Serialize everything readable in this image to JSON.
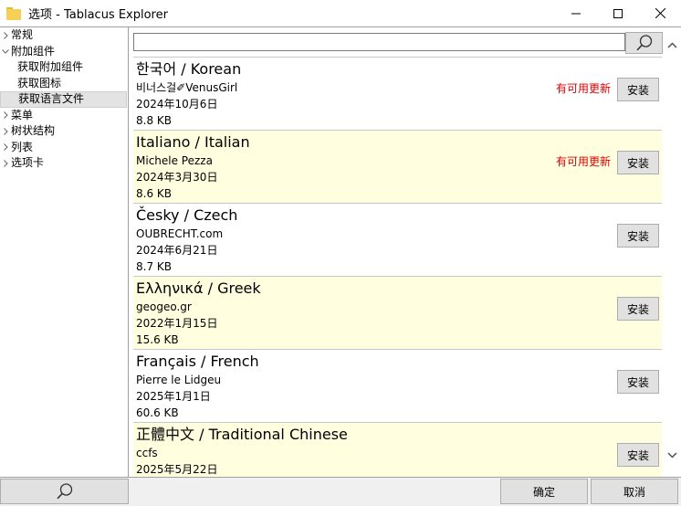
{
  "window": {
    "title": "选项 - Tablacus Explorer"
  },
  "icons": {
    "app": "folder-icon",
    "minimize": "minimize-icon",
    "maximize": "maximize-icon",
    "close": "close-icon",
    "search": "search-icon",
    "scroll_up": "chevron-up-icon",
    "scroll_down": "chevron-down-icon"
  },
  "tree": {
    "items": [
      {
        "label": "常规",
        "level": 0,
        "expanded": false
      },
      {
        "label": "附加组件",
        "level": 0,
        "expanded": true
      },
      {
        "label": "获取附加组件",
        "level": 1
      },
      {
        "label": "获取图标",
        "level": 1
      },
      {
        "label": "获取语言文件",
        "level": 1,
        "selected": true
      },
      {
        "label": "菜单",
        "level": 0,
        "expanded": false
      },
      {
        "label": "树状结构",
        "level": 0,
        "expanded": false
      },
      {
        "label": "列表",
        "level": 0,
        "expanded": false
      },
      {
        "label": "选项卡",
        "level": 0,
        "expanded": false
      }
    ]
  },
  "search": {
    "value": ""
  },
  "languages": [
    {
      "title": "한국어 / Korean",
      "author": "비너스걸✐VenusGirl",
      "date": "2024年10月6日",
      "size": "8.8 KB",
      "update": "有可用更新",
      "install": "安装"
    },
    {
      "title": "Italiano / Italian",
      "author": "Michele Pezza",
      "date": "2024年3月30日",
      "size": "8.6 KB",
      "update": "有可用更新",
      "install": "安装"
    },
    {
      "title": "Česky / Czech",
      "author": "OUBRECHT.com",
      "date": "2024年6月21日",
      "size": "8.7 KB",
      "update": "",
      "install": "安装"
    },
    {
      "title": "Ελληνικά / Greek",
      "author": "geogeo.gr",
      "date": "2022年1月15日",
      "size": "15.6 KB",
      "update": "",
      "install": "安装"
    },
    {
      "title": "Français / French",
      "author": "Pierre le Lidgeu",
      "date": "2025年1月1日",
      "size": "60.6 KB",
      "update": "",
      "install": "安装"
    },
    {
      "title": "正體中文 / Traditional Chinese",
      "author": "ccfs",
      "date": "2025年5月22日",
      "size": "",
      "update": "",
      "install": "安装"
    }
  ],
  "buttons": {
    "ok": "确定",
    "cancel": "取消"
  },
  "colors": {
    "alt_row": "#ffffe0",
    "update_text": "#e00000",
    "selected_tree": "#e3e3e3"
  }
}
